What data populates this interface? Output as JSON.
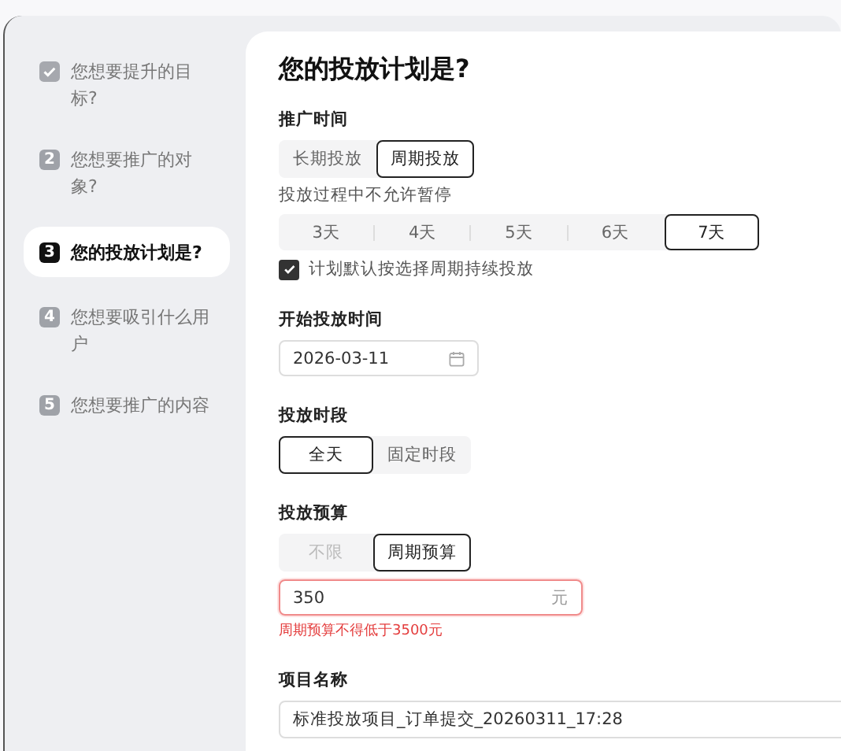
{
  "sidebar": {
    "steps": [
      {
        "kind": "done",
        "label": "您想要提升的目标?",
        "selected": false
      },
      {
        "kind": "number",
        "number": "2",
        "label": "您想要推广的对象?",
        "selected": false
      },
      {
        "kind": "number",
        "number": "3",
        "label": "您的投放计划是?",
        "selected": true
      },
      {
        "kind": "number",
        "number": "4",
        "label": "您想要吸引什么用户",
        "selected": false
      },
      {
        "kind": "number",
        "number": "5",
        "label": "您想要推广的内容",
        "selected": false
      }
    ]
  },
  "main": {
    "title": "您的投放计划是?",
    "promo_time": {
      "label": "推广时间",
      "options": [
        {
          "label": "长期投放",
          "selected": false
        },
        {
          "label": "周期投放",
          "selected": true
        }
      ],
      "note": "投放过程中不允许暂停",
      "days": [
        {
          "label": "3天",
          "selected": false
        },
        {
          "label": "4天",
          "selected": false
        },
        {
          "label": "5天",
          "selected": false
        },
        {
          "label": "6天",
          "selected": false
        },
        {
          "label": "7天",
          "selected": true
        }
      ],
      "continue_checkbox": {
        "label": "计划默认按选择周期持续投放",
        "checked": true
      }
    },
    "start_time": {
      "label": "开始投放时间",
      "value": "2026-03-11"
    },
    "time_slot": {
      "label": "投放时段",
      "options": [
        {
          "label": "全天",
          "selected": true
        },
        {
          "label": "固定时段",
          "selected": false
        }
      ]
    },
    "budget": {
      "label": "投放预算",
      "options": [
        {
          "label": "不限",
          "selected": false
        },
        {
          "label": "周期预算",
          "selected": true
        }
      ],
      "value": "350",
      "unit": "元",
      "error": "周期预算不得低于3500元"
    },
    "project_name": {
      "label": "项目名称",
      "value": "标准投放项目_订单提交_20260311_17:28"
    }
  }
}
